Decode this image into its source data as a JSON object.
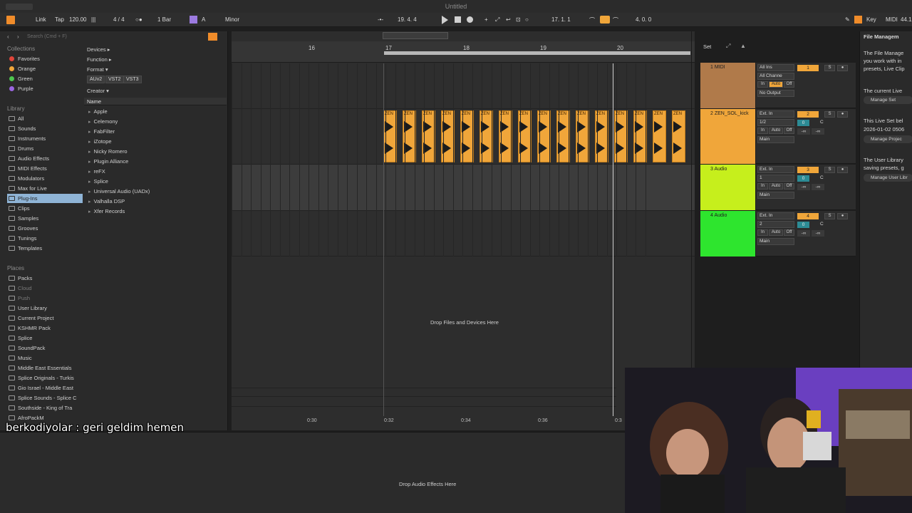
{
  "window": {
    "title": "Untitled"
  },
  "controlbar": {
    "link": "Link",
    "tap": "Tap",
    "tempo": "120.00",
    "time_signature": "4 / 4",
    "quantize": "1 Bar",
    "key": "A",
    "scale": "Minor",
    "position": "19.  4.  4",
    "loop_start": "17.  1.  1",
    "loop_length": "4.  0.  0",
    "key_button": "Key",
    "midi_button": "MIDI",
    "cpu": "44.1"
  },
  "browser": {
    "search_placeholder": "Search (Cmd + F)",
    "collections_header": "Collections",
    "collections": [
      {
        "label": "Favorites",
        "color": "#e0453a"
      },
      {
        "label": "Orange",
        "color": "#f0a63a"
      },
      {
        "label": "Green",
        "color": "#4ec64e"
      },
      {
        "label": "Purple",
        "color": "#9a66e0"
      }
    ],
    "library_header": "Library",
    "library": [
      "All",
      "Sounds",
      "Instruments",
      "Drums",
      "Audio Effects",
      "MIDI Effects",
      "Modulators",
      "Max for Live",
      "Plug-Ins",
      "Clips",
      "Samples",
      "Grooves",
      "Tunings",
      "Templates"
    ],
    "places_header": "Places",
    "places": [
      "Packs",
      "Cloud",
      "Push",
      "User Library",
      "Current Project",
      "KSHMR Pack",
      "Splice",
      "SoundPack",
      "Music",
      "Middle East Essentials",
      "Splice Originals - Turkis",
      "Gio Israel - Middle East",
      "Splice Sounds - Splice C",
      "Southside - King of Tra",
      "AfroPackM"
    ],
    "filters": {
      "devices": "Devices ▸",
      "function": "Function ▸",
      "format": "Format ▾",
      "format_tags": [
        "AUv2",
        "VST2",
        "VST3"
      ],
      "creator": "Creator ▾"
    },
    "name_header": "Name",
    "names": [
      "Apple",
      "Celemony",
      "FabFilter",
      "iZotope",
      "Nicky Romero",
      "Plugin Alliance",
      "reFX",
      "Splice",
      "Universal Audio (UADx)",
      "Valhalla DSP",
      "Xfer Records"
    ]
  },
  "arrangement": {
    "bar_numbers": [
      "16",
      "17",
      "18",
      "19",
      "20"
    ],
    "clip_label": "ZEN",
    "clip_count": 16,
    "drop_files": "Drop Files and Devices Here",
    "time_labels": [
      "0:30",
      "0:32",
      "0:34",
      "0:36",
      "0:3"
    ]
  },
  "tracks_header": {
    "set_button": "Set"
  },
  "tracks": [
    {
      "name": "1 MIDI",
      "color": "#b07a4a",
      "input": "All Ins",
      "channel": "All Channe",
      "output": "No Output",
      "number": "1",
      "monitor": [
        "In",
        "Auto",
        "Off"
      ]
    },
    {
      "name": "2 ZEN_SOL_kick",
      "color": "#f0a63a",
      "input": "Ext. In",
      "channel": "1/2",
      "output": "Main",
      "number": "2",
      "gain": "0",
      "pan": "C",
      "sends": "-∞",
      "monitor": [
        "In",
        "Auto",
        "Off"
      ]
    },
    {
      "name": "3 Audio",
      "color": "#c6ef1c",
      "input": "Ext. In",
      "channel": "1",
      "output": "Main",
      "number": "3",
      "gain": "0",
      "pan": "C",
      "sends": "-∞",
      "monitor": [
        "In",
        "Auto",
        "Off"
      ]
    },
    {
      "name": "4 Audio",
      "color": "#2ee52e",
      "input": "Ext. In",
      "channel": "2",
      "output": "Main",
      "number": "4",
      "gain": "0",
      "pan": "C",
      "sends": "-∞",
      "monitor": [
        "In",
        "Auto",
        "Off"
      ]
    }
  ],
  "help": {
    "title": "File Managem",
    "lines": [
      "The File Manage",
      "you work with in",
      "presets, Live Clip",
      "The current Live",
      "This Live Set bel",
      "2026-01-02 0506",
      "The User Library",
      "saving presets, g"
    ],
    "buttons": [
      "Manage Set",
      "Manage Projec",
      "Manage User Libr"
    ]
  },
  "device_area": {
    "drop_label": "Drop Audio Effects Here"
  },
  "chat": {
    "user": "berkodiyolar",
    "message": ": geri geldim hemen"
  }
}
